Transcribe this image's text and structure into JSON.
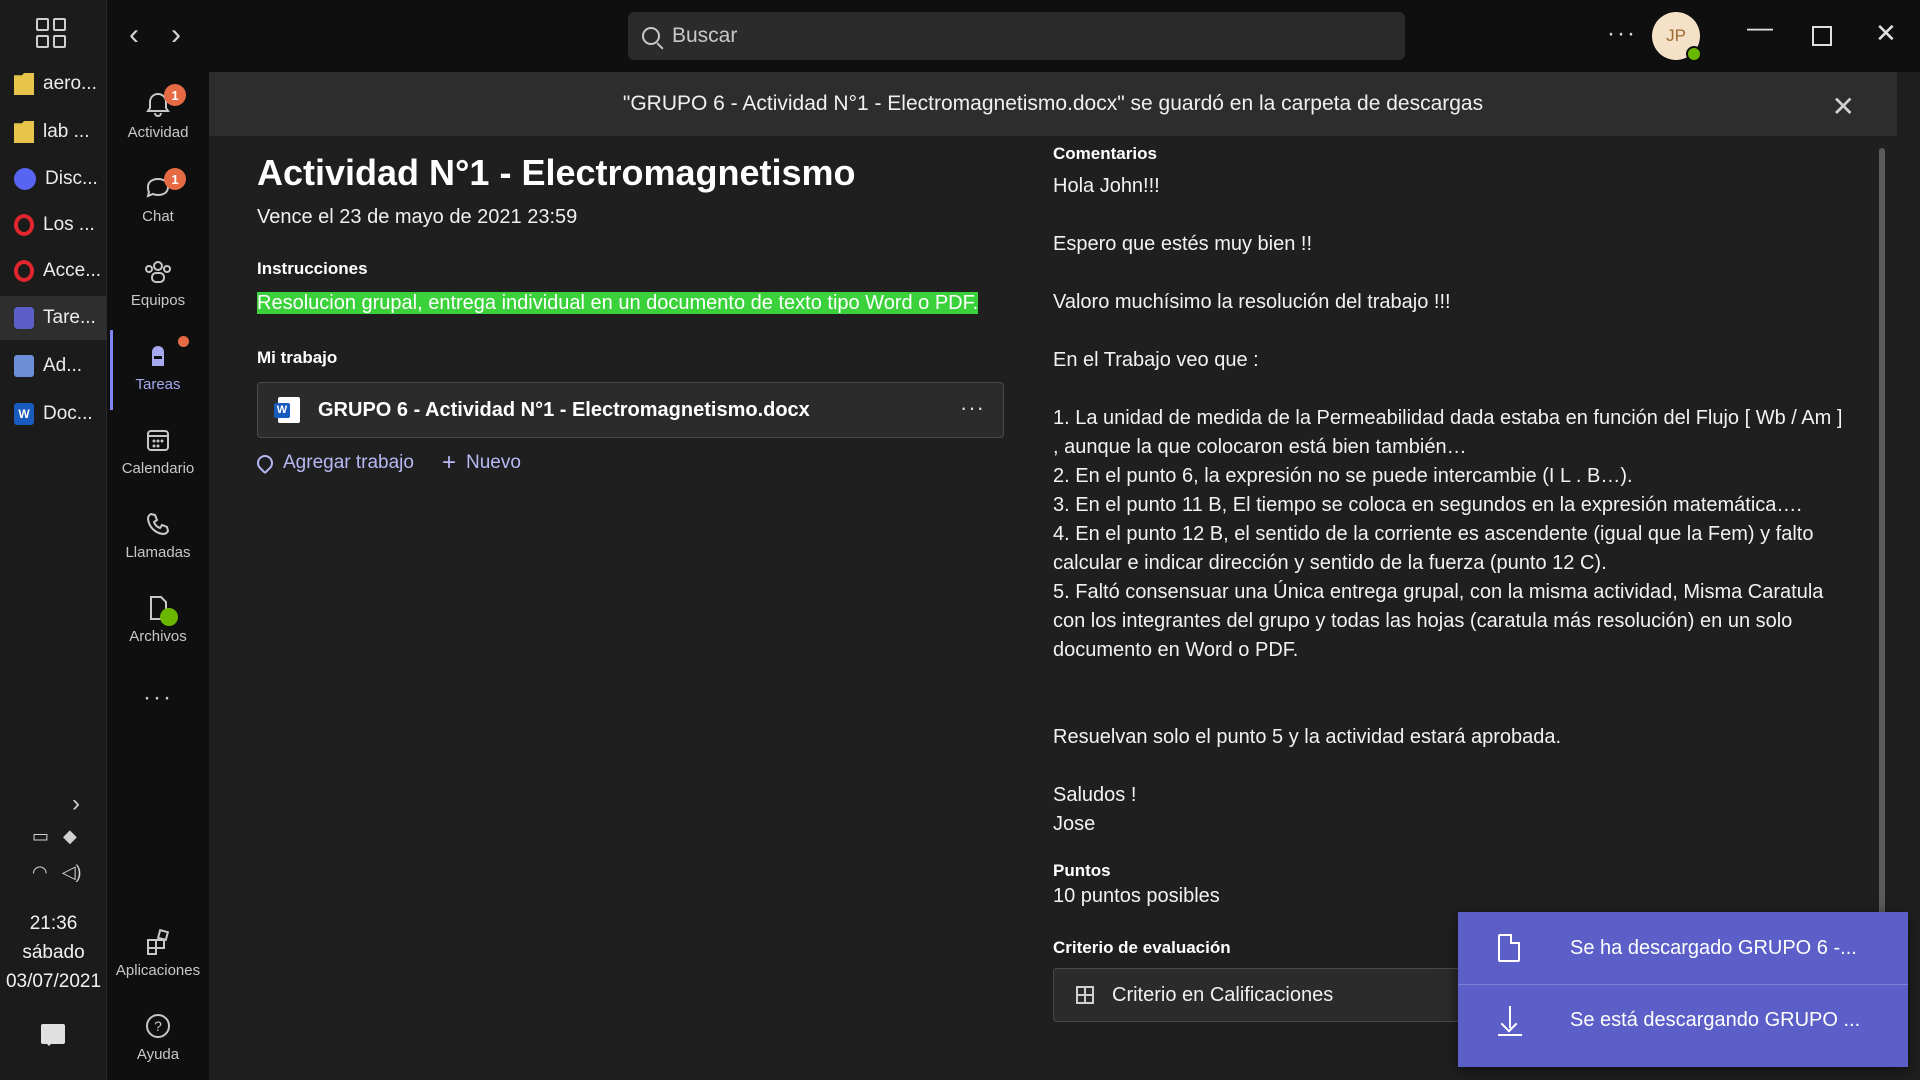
{
  "taskbar": {
    "items": [
      {
        "label": "aero...",
        "icon": "folder-icon"
      },
      {
        "label": "lab ...",
        "icon": "folder-icon"
      },
      {
        "label": "Disc...",
        "icon": "discord-icon"
      },
      {
        "label": "Los ...",
        "icon": "opera-icon"
      },
      {
        "label": "Acce...",
        "icon": "opera-icon"
      },
      {
        "label": "Tare...",
        "icon": "teams-icon"
      },
      {
        "label": "Ad...",
        "icon": "mail-icon"
      },
      {
        "label": "Doc...",
        "icon": "word-icon"
      }
    ],
    "word_glyph": "W",
    "clock": {
      "time": "21:36",
      "day": "sábado",
      "date": "03/07/2021"
    }
  },
  "titlebar": {
    "search_placeholder": "Buscar",
    "more": "···",
    "avatar_initials": "JP"
  },
  "rail": {
    "items": [
      {
        "label": "Actividad",
        "badge": "1"
      },
      {
        "label": "Chat",
        "badge": "1"
      },
      {
        "label": "Equipos"
      },
      {
        "label": "Tareas"
      },
      {
        "label": "Calendario"
      },
      {
        "label": "Llamadas"
      },
      {
        "label": "Archivos"
      }
    ],
    "more": "···",
    "bottom": [
      {
        "label": "Aplicaciones"
      },
      {
        "label": "Ayuda"
      }
    ]
  },
  "banner": {
    "text": "\"GRUPO 6 - Actividad N°1 - Electromagnetismo.docx\" se guardó en la carpeta de descargas"
  },
  "assignment": {
    "title": "Actividad N°1 - Electromagnetismo",
    "due": "Vence el 23 de mayo de 2021 23:59",
    "instructions_label": "Instrucciones",
    "instructions": "Resolucion grupal, entrega individual en un documento de texto tipo Word o PDF.",
    "my_work_label": "Mi trabajo",
    "file_name": "GRUPO 6 - Actividad N°1 - Electromagnetismo.docx",
    "file_more": "···",
    "add_work": "Agregar trabajo",
    "new": "Nuevo"
  },
  "feedback": {
    "comments_label": "Comentarios",
    "greeting": "Hola John!!!",
    "line1": "Espero que estés muy bien  !!",
    "line2": "Valoro muchísimo la resolución del trabajo !!!",
    "line3": "En el Trabajo veo que :",
    "items": [
      "1.      La unidad de medida de la Permeabilidad dada estaba en función del Flujo [ Wb / Am ] , aunque la que colocaron está bien también…",
      "2.      En el punto 6, la expresión no se puede intercambie  (I L . B…).",
      "3.      En el punto 11 B, El tiempo se coloca en segundos en la expresión matemática….",
      "4.      En el punto 12 B, el sentido de la corriente es ascendente (igual que la Fem) y falto calcular e indicar dirección y sentido de la fuerza (punto 12 C).",
      "5.      Faltó consensuar una Única entrega grupal, con la misma actividad, Misma Caratula con los integrantes del grupo y todas las hojas  (caratula más resolución) en un solo documento en Word o PDF."
    ],
    "closing": "Resuelvan solo el punto 5 y la actividad estará aprobada.",
    "sign1": "Saludos  !",
    "sign2": "Jose",
    "points_label": "Puntos",
    "points": "10 puntos posibles",
    "criteria_label": "Criterio de evaluación",
    "criteria_button": "Criterio en Calificaciones"
  },
  "downloads": {
    "completed": "Se ha descargado GRUPO 6 -...",
    "in_progress": "Se está descargando GRUPO ..."
  }
}
